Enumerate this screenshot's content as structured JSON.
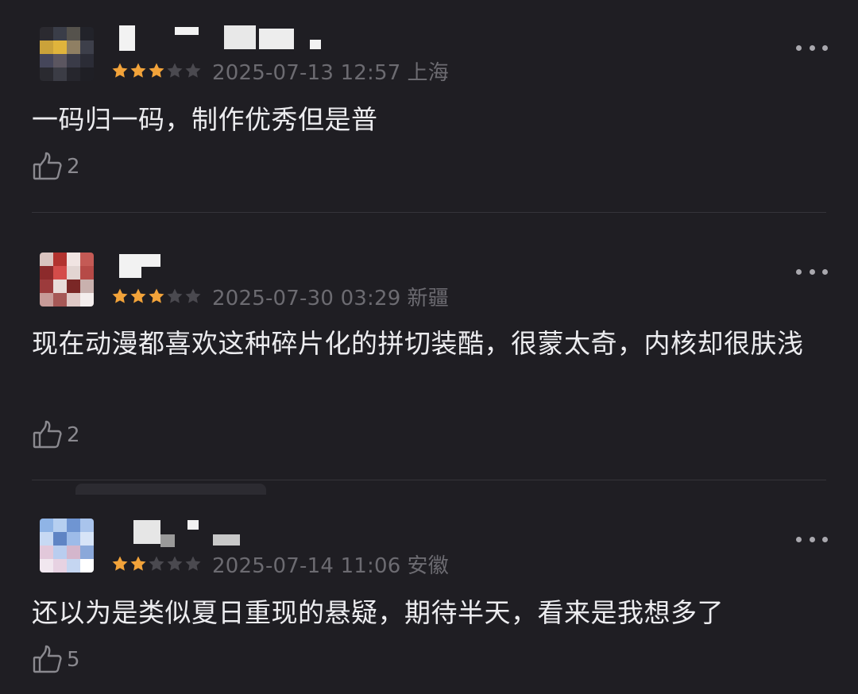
{
  "comments": [
    {
      "rating": 3,
      "rating_max": 5,
      "date": "2025-07-13 12:57",
      "location": "上海",
      "text": "一码归一码，制作优秀但是普",
      "likes": "2",
      "avatar_palette": [
        "#2b2a30",
        "#3a3d48",
        "#55524c",
        "#22232a",
        "#caa23a",
        "#e0b43c",
        "#8f7f63",
        "#3d3f4a",
        "#45465a",
        "#5b5660",
        "#3a3b48",
        "#2b2c36",
        "#2a2a30",
        "#3b3c45",
        "#26262d",
        "#1f1f25"
      ]
    },
    {
      "rating": 3,
      "rating_max": 5,
      "date": "2025-07-30 03:29",
      "location": "新疆",
      "text": "现在动漫都喜欢这种碎片化的拼切装酷，很蒙太奇，内核却很肤浅",
      "likes": "2",
      "avatar_palette": [
        "#d9c3bf",
        "#b2332f",
        "#f0e4e2",
        "#c45a55",
        "#8c2a2b",
        "#d44c4a",
        "#e2d5d2",
        "#b64a47",
        "#9c3b3c",
        "#e8dcd9",
        "#7a2726",
        "#c9b1ae",
        "#c79b98",
        "#a65856",
        "#dfc9c6",
        "#f4eeed"
      ]
    },
    {
      "rating": 2,
      "rating_max": 5,
      "date": "2025-07-14 11:06",
      "location": "安徽",
      "text": "还以为是类似夏日重现的悬疑，期待半天，看来是我想多了",
      "likes": "5",
      "avatar_palette": [
        "#8fb4e6",
        "#b6cff0",
        "#6f95d2",
        "#a9c4ec",
        "#c7d9f3",
        "#5f84c4",
        "#9dbbe8",
        "#d7e4f7",
        "#e2c8da",
        "#b9cdef",
        "#d4b6cc",
        "#8aa8da",
        "#f1e7ef",
        "#e7d2e2",
        "#c5d6f1",
        "#ffffff"
      ]
    }
  ],
  "colors": {
    "background": "#1f1e23",
    "star_filled": "#f2a33a",
    "star_empty": "#4a494f",
    "meta_text": "#6c6b71",
    "divider": "#35343a"
  }
}
